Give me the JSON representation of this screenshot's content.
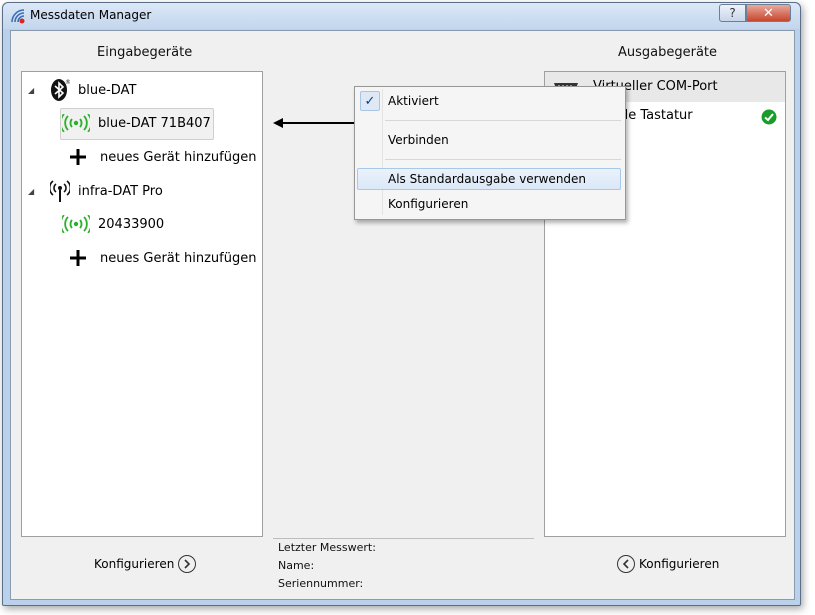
{
  "window": {
    "title": "Messdaten Manager",
    "help_label": "?",
    "close_label": "✕"
  },
  "input_panel": {
    "heading": "Eingabegeräte",
    "groups": [
      {
        "label": "blue-DAT",
        "icon": "bluetooth-icon",
        "devices": [
          {
            "label": "blue-DAT 71B407",
            "icon": "wireless-signal-icon",
            "selected": true
          }
        ],
        "add_label": "neues Gerät hinzufügen"
      },
      {
        "label": "infra-DAT Pro",
        "icon": "antenna-icon",
        "devices": [
          {
            "label": "20433900",
            "icon": "wireless-signal-icon",
            "selected": false
          }
        ],
        "add_label": "neues Gerät hinzufügen"
      }
    ],
    "configure_label": "Konfigurieren"
  },
  "output_panel": {
    "heading": "Ausgabegeräte",
    "items": [
      {
        "label": "Virtueller COM-Port",
        "visible_text": "Virtueller COM-Port",
        "icon": "com-port-icon"
      },
      {
        "label": "Virtuelle Tastatur",
        "visible_text": "lle Tastatur",
        "icon": "check-circle-icon",
        "status_color": "#1a9c2a"
      }
    ],
    "configure_label": "Konfigurieren"
  },
  "info": {
    "last_value_label": "Letzter Messwert:",
    "name_label": "Name:",
    "serial_label": "Seriennummer:"
  },
  "context_menu": {
    "items": [
      {
        "label": "Aktiviert",
        "checked": true
      },
      {
        "label": "Verbinden"
      },
      {
        "label": "Als Standardausgabe verwenden",
        "hovered": true
      },
      {
        "label": "Konfigurieren"
      }
    ]
  },
  "colors": {
    "signal_green": "#2bb02b",
    "check_green": "#1a9c2a",
    "window_frame": "#b9d1ea",
    "close_red": "#c7462f"
  }
}
